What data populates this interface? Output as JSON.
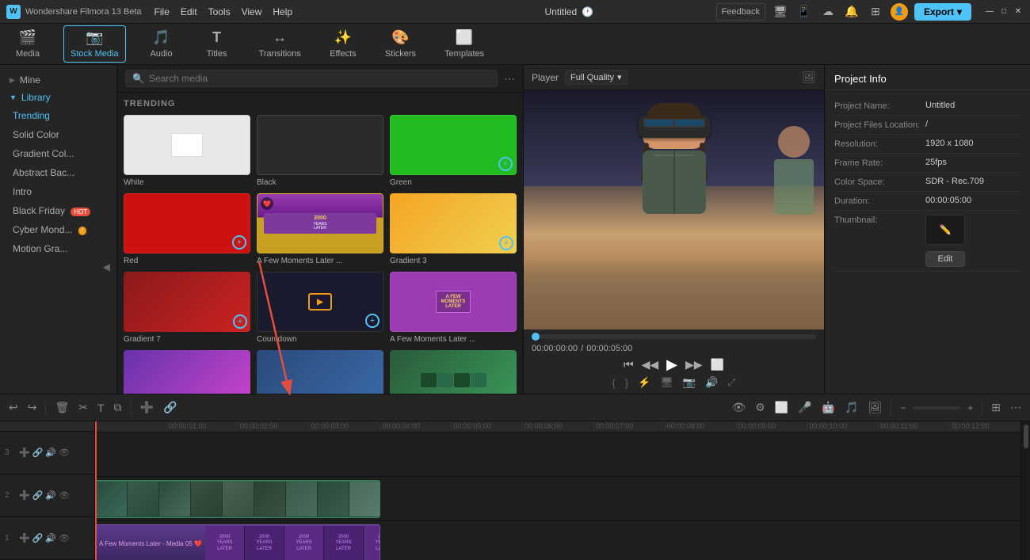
{
  "app": {
    "name": "Wondershare Filmora 13 Beta",
    "logo_text": "W",
    "title": "Untitled",
    "version": "13 Beta"
  },
  "menu": {
    "items": [
      "File",
      "Edit",
      "Tools",
      "View",
      "Help"
    ]
  },
  "window_controls": {
    "minimize": "—",
    "maximize": "□",
    "close": "✕"
  },
  "toolbar": {
    "items": [
      {
        "id": "media",
        "label": "Media",
        "icon": "🎬"
      },
      {
        "id": "stock-media",
        "label": "Stock Media",
        "icon": "📷"
      },
      {
        "id": "audio",
        "label": "Audio",
        "icon": "🎵"
      },
      {
        "id": "titles",
        "label": "Titles",
        "icon": "T"
      },
      {
        "id": "transitions",
        "label": "Transitions",
        "icon": "↔"
      },
      {
        "id": "effects",
        "label": "Effects",
        "icon": "✨"
      },
      {
        "id": "stickers",
        "label": "Stickers",
        "icon": "🎨"
      },
      {
        "id": "templates",
        "label": "Templates",
        "icon": "⬜"
      }
    ],
    "active": "stock-media"
  },
  "sidebar": {
    "mine_label": "Mine",
    "library_label": "Library",
    "items": [
      {
        "id": "trending",
        "label": "Trending",
        "active": true
      },
      {
        "id": "solid-color",
        "label": "Solid Color"
      },
      {
        "id": "gradient-col",
        "label": "Gradient Col..."
      },
      {
        "id": "abstract-bac",
        "label": "Abstract Bac..."
      },
      {
        "id": "intro",
        "label": "Intro"
      },
      {
        "id": "black-friday",
        "label": "Black Friday",
        "badge": "hot"
      },
      {
        "id": "cyber-mond",
        "label": "Cyber Mond...",
        "badge_yellow": "!"
      },
      {
        "id": "motion-gra",
        "label": "Motion Gra..."
      }
    ]
  },
  "media_panel": {
    "search_placeholder": "Search media",
    "section_title": "TRENDING",
    "items": [
      {
        "id": "white",
        "label": "White",
        "bg": "#ffffff",
        "has_add": false
      },
      {
        "id": "black",
        "label": "Black",
        "bg": "#1a1a1a",
        "has_add": false
      },
      {
        "id": "green",
        "label": "Green",
        "bg": "#00cc00",
        "has_add": true
      },
      {
        "id": "red",
        "label": "Red",
        "bg": "#cc0000",
        "has_add": true
      },
      {
        "id": "few-moments-later",
        "label": "A Few Moments Later ...",
        "bg": "#7b4ea6",
        "has_add": false,
        "is_spongebob": true
      },
      {
        "id": "gradient3",
        "label": "Gradient 3",
        "bg": "linear-gradient(135deg, #f5a623, #f0d060)",
        "has_add": true
      },
      {
        "id": "gradient7",
        "label": "Gradient 7",
        "bg": "linear-gradient(135deg, #8b1a1a, #cc2222)",
        "has_add": true
      },
      {
        "id": "countdown",
        "label": "Countdown",
        "bg": "#1a1a2e",
        "has_add": true,
        "is_countdown": true
      },
      {
        "id": "few-moments-later2",
        "label": "A Few Moments Later ...",
        "bg": "#7b4ea6",
        "has_add": false,
        "is_spongebob2": true
      }
    ],
    "row2": [
      {
        "id": "item10",
        "label": "",
        "bg": "#2a4a7a"
      },
      {
        "id": "item11",
        "label": "",
        "bg": "#3a5a3a"
      },
      {
        "id": "item12",
        "label": "",
        "bg": "#4a6a8a"
      }
    ]
  },
  "player": {
    "label": "Player",
    "quality": "Full Quality",
    "current_time": "00:00:00:00",
    "total_time": "00:00:05:00",
    "controls": {
      "rewind": "⏮",
      "step_back": "◀◀",
      "play": "▶",
      "step_fwd": "▶▶",
      "fullscreen": "⬜"
    }
  },
  "project_info": {
    "title": "Project Info",
    "fields": [
      {
        "key": "Project Name:",
        "value": "Untitled"
      },
      {
        "key": "Project Files Location:",
        "value": "/"
      },
      {
        "key": "Resolution:",
        "value": "1920 x 1080"
      },
      {
        "key": "Frame Rate:",
        "value": "25fps"
      },
      {
        "key": "Color Space:",
        "value": "SDR - Rec.709"
      },
      {
        "key": "Duration:",
        "value": "00:00:05:00"
      },
      {
        "key": "Thumbnail:",
        "value": ""
      }
    ],
    "edit_label": "Edit"
  },
  "timeline": {
    "ruler_marks": [
      "00:00:01:00",
      "00:00:02:00",
      "00:00:03:00",
      "00:00:04:00",
      "00:00:05:00",
      "00:00:06:00",
      "00:00:07:00",
      "00:00:08:00",
      "00:00:09:00",
      "00:00:10:00",
      "00:00:11:00",
      "00:00:12:00"
    ],
    "tracks": [
      {
        "num": "3",
        "type": "video"
      },
      {
        "num": "2",
        "type": "overlay"
      },
      {
        "num": "1",
        "type": "video"
      }
    ]
  },
  "export": {
    "label": "Export"
  }
}
